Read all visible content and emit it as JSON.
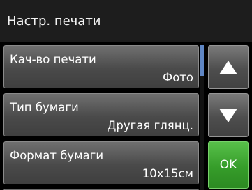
{
  "header": {
    "title": "Настр. печати"
  },
  "settings": [
    {
      "label": "Кач-во печати",
      "value": "Фото"
    },
    {
      "label": "Тип бумаги",
      "value": "Другая глянц."
    },
    {
      "label": "Формат бумаги",
      "value": "10x15см"
    }
  ],
  "buttons": {
    "up_icon": "triangle-up-icon",
    "down_icon": "triangle-down-icon",
    "ok_label": "OK"
  },
  "colors": {
    "ok_green": "#369d2a",
    "scroll_thumb": "#5f86c4",
    "title_bar": "#1d1d1d"
  },
  "scroll": {
    "position_fraction": 0.0
  }
}
